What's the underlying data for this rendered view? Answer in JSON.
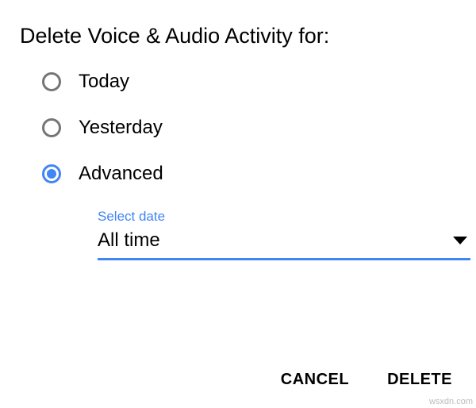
{
  "dialog": {
    "title": "Delete Voice & Audio Activity for:",
    "options": {
      "today": "Today",
      "yesterday": "Yesterday",
      "advanced": "Advanced"
    },
    "selected": "advanced",
    "dateField": {
      "label": "Select date",
      "value": "All time"
    },
    "actions": {
      "cancel": "CANCEL",
      "delete": "DELETE"
    }
  },
  "watermark": "wsxdn.com"
}
